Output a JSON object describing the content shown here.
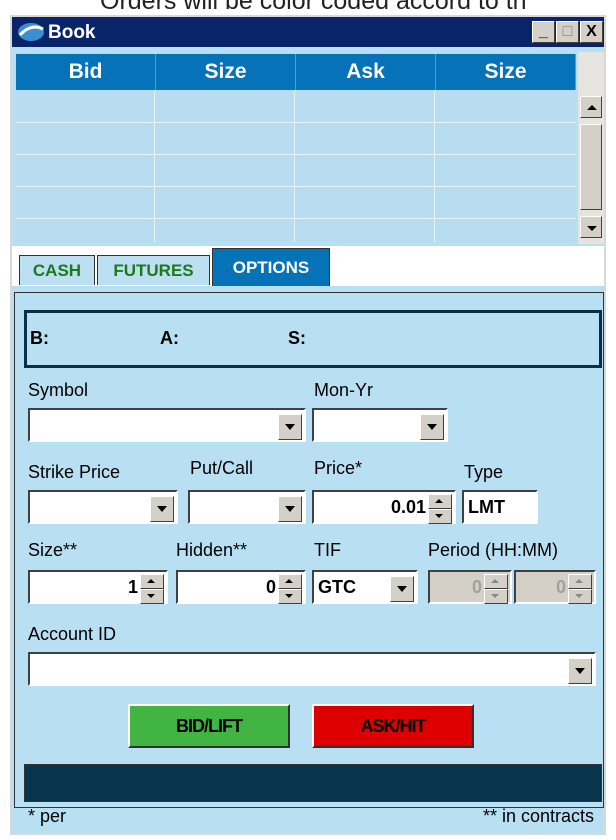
{
  "caption": "Orders will be color coded accord to th",
  "window": {
    "title": "Book",
    "min_btn": "_",
    "max_btn": "□",
    "close_btn": "X"
  },
  "book": {
    "columns": [
      "Bid",
      "Size",
      "Ask",
      "Size"
    ]
  },
  "tabs": [
    "CASH",
    "FUTURES",
    "OPTIONS"
  ],
  "quote": {
    "bid_label": "B:",
    "ask_label": "A:",
    "size_label": "S:"
  },
  "form": {
    "symbol_label": "Symbol",
    "symbol_value": "",
    "monyr_label": "Mon-Yr",
    "monyr_value": "",
    "strike_label": "Strike Price",
    "strike_value": "",
    "putcall_label": "Put/Call",
    "putcall_value": "",
    "price_label": "Price*",
    "price_value": "0.01",
    "type_label": "Type",
    "type_value": "LMT",
    "size_label": "Size**",
    "size_value": "1",
    "hidden_label": "Hidden**",
    "hidden_value": "0",
    "tif_label": "TIF",
    "tif_value": "GTC",
    "period_label": "Period (HH:MM)",
    "period_hh": "0",
    "period_mm": "0",
    "account_label": "Account ID",
    "account_value": ""
  },
  "buttons": {
    "bid": "BID/LIFT",
    "ask": "ASK/HIT"
  },
  "footer": {
    "left": "* per",
    "right": "** in contracts"
  },
  "colors": {
    "title_bar": "#0a246a",
    "header_blue": "#0672b8",
    "panel": "#b9dff3",
    "bid_green": "#41b441",
    "ask_red": "#dc0000",
    "status": "#08344e"
  },
  "icons": [
    "app-icon",
    "minimize-icon",
    "maximize-icon",
    "close-icon",
    "scroll-up-icon",
    "scroll-down-icon",
    "dropdown-arrow-icon",
    "spinner-icon"
  ]
}
